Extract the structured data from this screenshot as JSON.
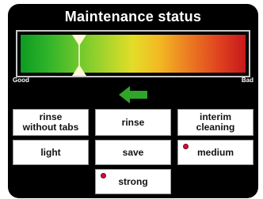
{
  "title": "Maintenance status",
  "gauge": {
    "left_label": "Good",
    "right_label": "Bad",
    "colors": [
      "#0e9a22",
      "#e4dd27",
      "#c7181c"
    ],
    "marker_level": 0.26
  },
  "arrow": {
    "icon": "left-arrow-icon",
    "color": "#2fa52a"
  },
  "buttons": {
    "rinse_without_tabs": "rinse\nwithout tabs",
    "rinse": "rinse",
    "interim_cleaning": "interim\ncleaning",
    "light": "light",
    "save": "save",
    "medium": "medium",
    "strong": "strong"
  },
  "indicator_color": "#d0103a"
}
